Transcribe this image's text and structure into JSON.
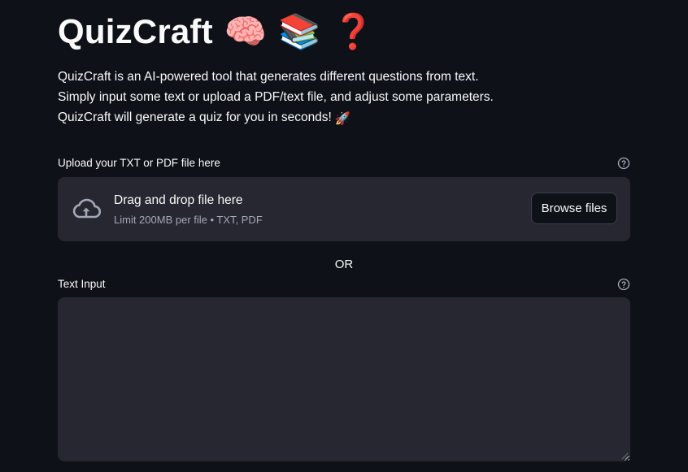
{
  "header": {
    "title": "QuizCraft",
    "emojis": [
      "🧠",
      "📚",
      "❓"
    ]
  },
  "description": {
    "lines": [
      "QuizCraft is an AI-powered tool that generates different questions from text.",
      "Simply input some text or upload a PDF/text file, and adjust some parameters.",
      "QuizCraft will generate a quiz for you in seconds!"
    ],
    "rocket_emoji": "🚀"
  },
  "uploader": {
    "label": "Upload your TXT or PDF file here",
    "help_icon": "question-circle-icon",
    "drop_title": "Drag and drop file here",
    "drop_subtitle": "Limit 200MB per file • TXT, PDF",
    "browse_label": "Browse files",
    "icon": "cloud-upload-icon"
  },
  "separator": "OR",
  "text_input": {
    "label": "Text Input",
    "help_icon": "question-circle-icon",
    "value": "",
    "placeholder": ""
  },
  "colors": {
    "background": "#0e1117",
    "widget_background": "#262730",
    "text": "#fafafa",
    "muted_text": "#a3a8b8"
  }
}
